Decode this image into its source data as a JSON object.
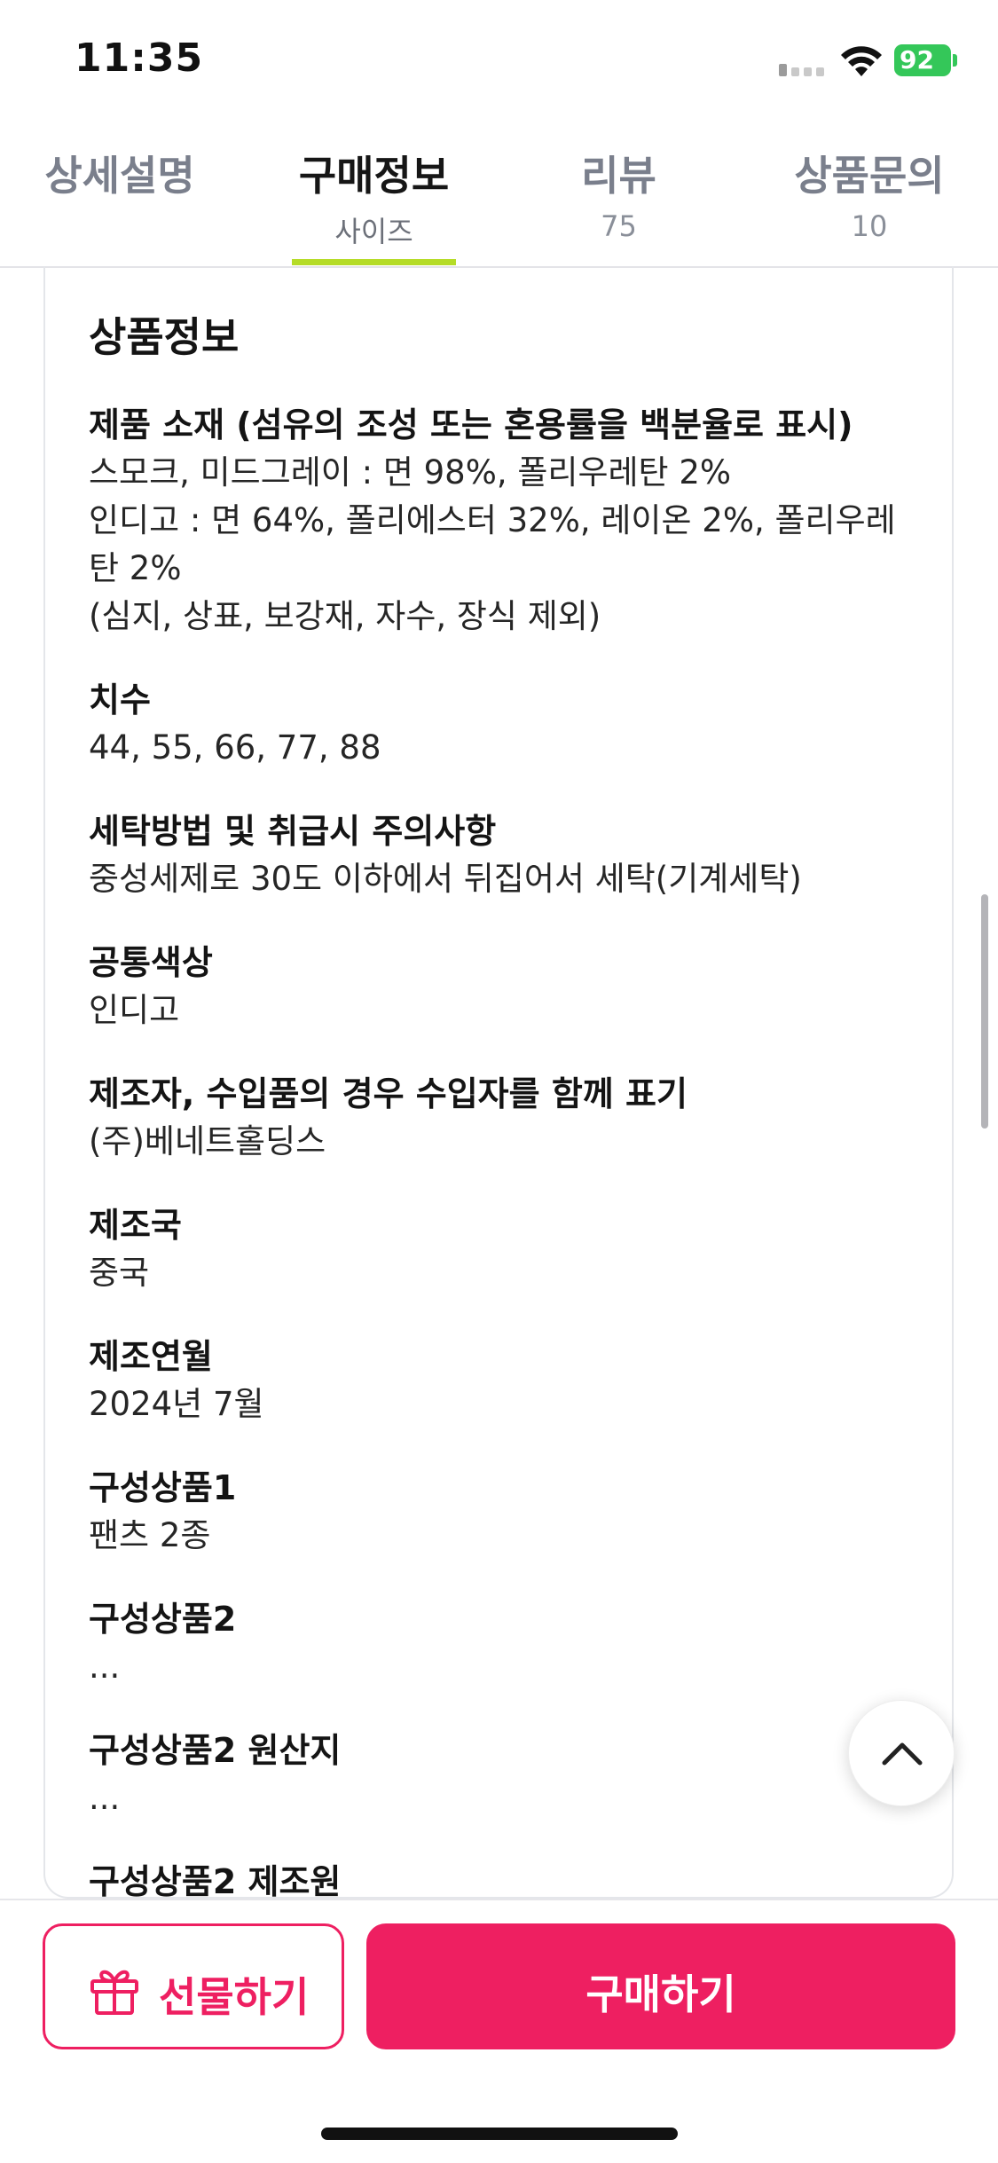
{
  "status_bar": {
    "time": "11:35",
    "battery": "92"
  },
  "tabs": [
    {
      "label": "상세설명",
      "sub": ""
    },
    {
      "label": "구매정보",
      "sub": "사이즈"
    },
    {
      "label": "리뷰",
      "sub": "75"
    },
    {
      "label": "상품문의",
      "sub": "10"
    }
  ],
  "product_info": {
    "title": "상품정보",
    "items": [
      {
        "label": "제품 소재 (섬유의 조성 또는 혼용률을 백분율로 표시)",
        "value": "스모크, 미드그레이 : 면 98%, 폴리우레탄 2%\n인디고 : 면 64%, 폴리에스터 32%, 레이온 2%, 폴리우레\n탄 2%\n(심지, 상표, 보강재, 자수, 장식 제외)"
      },
      {
        "label": "치수",
        "value": "44, 55, 66, 77, 88"
      },
      {
        "label": "세탁방법 및 취급시 주의사항",
        "value": "중성세제로 30도 이하에서 뒤집어서 세탁(기계세탁)"
      },
      {
        "label": "공통색상",
        "value": "인디고"
      },
      {
        "label": "제조자, 수입품의 경우 수입자를 함께 표기",
        "value": "(주)베네트홀딩스"
      },
      {
        "label": "제조국",
        "value": "중국"
      },
      {
        "label": "제조연월",
        "value": "2024년 7월"
      },
      {
        "label": "구성상품1",
        "value": "팬츠 2종"
      },
      {
        "label": "구성상품2",
        "value": "..."
      },
      {
        "label": "구성상품2 원산지",
        "value": "..."
      },
      {
        "label": "구성상품2 제조원",
        "value": ""
      }
    ]
  },
  "actions": {
    "gift_label": "선물하기",
    "buy_label": "구매하기"
  },
  "colors": {
    "accent_pink": "#ee1f61",
    "tab_indicator": "#b5dc27",
    "battery_green": "#34c759"
  },
  "icons": {
    "gift": "gift-icon",
    "scroll_top": "chevron-up-icon",
    "wifi": "wifi-icon",
    "signal": "cellular-signal-icon",
    "battery": "battery-icon"
  }
}
